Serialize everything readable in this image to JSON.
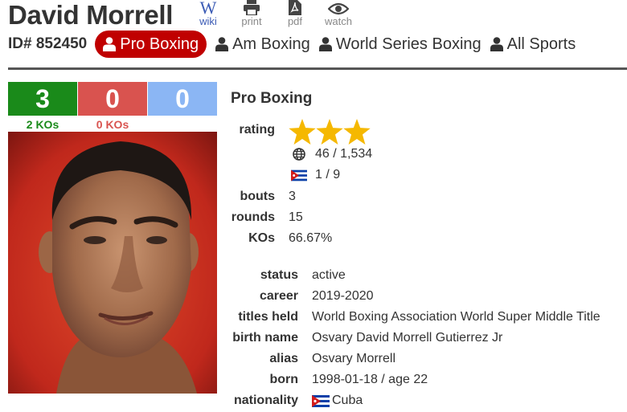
{
  "header": {
    "name": "David Morrell",
    "id_text": "ID# 852450"
  },
  "tools": [
    {
      "label": "wiki",
      "icon": "wikipedia-icon"
    },
    {
      "label": "print",
      "icon": "printer-icon"
    },
    {
      "label": "pdf",
      "icon": "pdf-icon"
    },
    {
      "label": "watch",
      "icon": "eye-icon"
    }
  ],
  "sports": [
    {
      "label": "Pro Boxing",
      "active": true
    },
    {
      "label": "Am Boxing",
      "active": false
    },
    {
      "label": "World Series Boxing",
      "active": false
    },
    {
      "label": "All Sports",
      "active": false
    }
  ],
  "record": {
    "wins": "3",
    "losses": "0",
    "draws": "0",
    "win_kos": "2 KOs",
    "loss_kos": "0 KOs"
  },
  "profile": {
    "section_title": "Pro Boxing",
    "rating_label": "rating",
    "rating_stars": 3,
    "world_rank": "46 / 1,534",
    "country_rank": "1 / 9",
    "bouts_label": "bouts",
    "bouts": "3",
    "rounds_label": "rounds",
    "rounds": "15",
    "kos_label": "KOs",
    "kos_pct": "66.67%"
  },
  "bio": {
    "status_label": "status",
    "status": "active",
    "career_label": "career",
    "career": "2019-2020",
    "titles_label": "titles held",
    "titles": "World Boxing Association World Super Middle Title",
    "birthname_label": "birth name",
    "birthname": "Osvary David Morrell Gutierrez Jr",
    "alias_label": "alias",
    "alias": "Osvary Morrell",
    "born_label": "born",
    "born": "1998-01-18 / age 22",
    "nationality_label": "nationality",
    "nationality": "Cuba"
  },
  "colors": {
    "win": "#1a8a1a",
    "loss": "#d9534f",
    "draw": "#8bb6f4",
    "active_tab": "#c00000",
    "star": "#f5b800"
  }
}
